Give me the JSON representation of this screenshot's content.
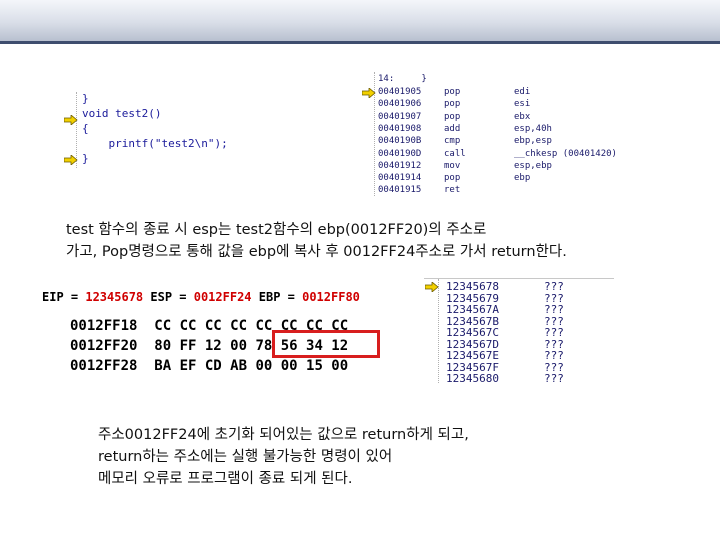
{
  "source_code": {
    "lines": [
      "}",
      "void test2()",
      "{",
      "    printf(\"test2\\n\");",
      "}"
    ]
  },
  "disassembly": {
    "header": "14:     }",
    "rows": [
      {
        "addr": "00401905",
        "op": "pop",
        "arg": "edi"
      },
      {
        "addr": "00401906",
        "op": "pop",
        "arg": "esi"
      },
      {
        "addr": "00401907",
        "op": "pop",
        "arg": "ebx"
      },
      {
        "addr": "00401908",
        "op": "add",
        "arg": "esp,40h"
      },
      {
        "addr": "0040190B",
        "op": "cmp",
        "arg": "ebp,esp"
      },
      {
        "addr": "0040190D",
        "op": "call",
        "arg": "__chkesp (00401420)"
      },
      {
        "addr": "00401912",
        "op": "mov",
        "arg": "esp,ebp"
      },
      {
        "addr": "00401914",
        "op": "pop",
        "arg": "ebp"
      },
      {
        "addr": "00401915",
        "op": "ret",
        "arg": ""
      }
    ]
  },
  "explanation_1": {
    "line1": "test 함수의 종료 시 esp는 test2함수의 ebp(0012FF20)의 주소로",
    "line2": "가고, Pop명령으로 통해 값을 ebp에 복사 후 0012FF24주소로 가서 return한다."
  },
  "registers": {
    "eip_label": "EIP = ",
    "eip_value": "12345678",
    "esp_label": " ESP = ",
    "esp_value": "0012FF24",
    "ebp_label": " EBP = ",
    "ebp_value": "0012FF80"
  },
  "memory": {
    "rows": [
      {
        "addr": "0012FF18",
        "bytes": "CC CC CC CC CC CC CC CC"
      },
      {
        "addr": "0012FF20",
        "bytes": "80 FF 12 00 78 56 34 12"
      },
      {
        "addr": "0012FF28",
        "bytes": "BA EF CD AB 00 00 15 00"
      }
    ]
  },
  "address_list": {
    "rows": [
      {
        "addr": "12345678",
        "val": "???"
      },
      {
        "addr": "12345679",
        "val": "???"
      },
      {
        "addr": "1234567A",
        "val": "???"
      },
      {
        "addr": "1234567B",
        "val": "???"
      },
      {
        "addr": "1234567C",
        "val": "???"
      },
      {
        "addr": "1234567D",
        "val": "???"
      },
      {
        "addr": "1234567E",
        "val": "???"
      },
      {
        "addr": "1234567F",
        "val": "???"
      },
      {
        "addr": "12345680",
        "val": "???"
      }
    ]
  },
  "explanation_2": {
    "line1": "주소0012FF24에 초기화 되어있는 값으로 return하게 되고,",
    "line2": "return하는 주소에는 실행 불가능한 명령이 있어",
    "line3": "메모리 오류로 프로그램이 종료 되게 된다."
  },
  "colors": {
    "register_value": "#d00000",
    "highlight_box": "#d81e1e",
    "code_text": "#1a1a9a"
  },
  "icons": [
    "current-line-arrow-icon"
  ]
}
